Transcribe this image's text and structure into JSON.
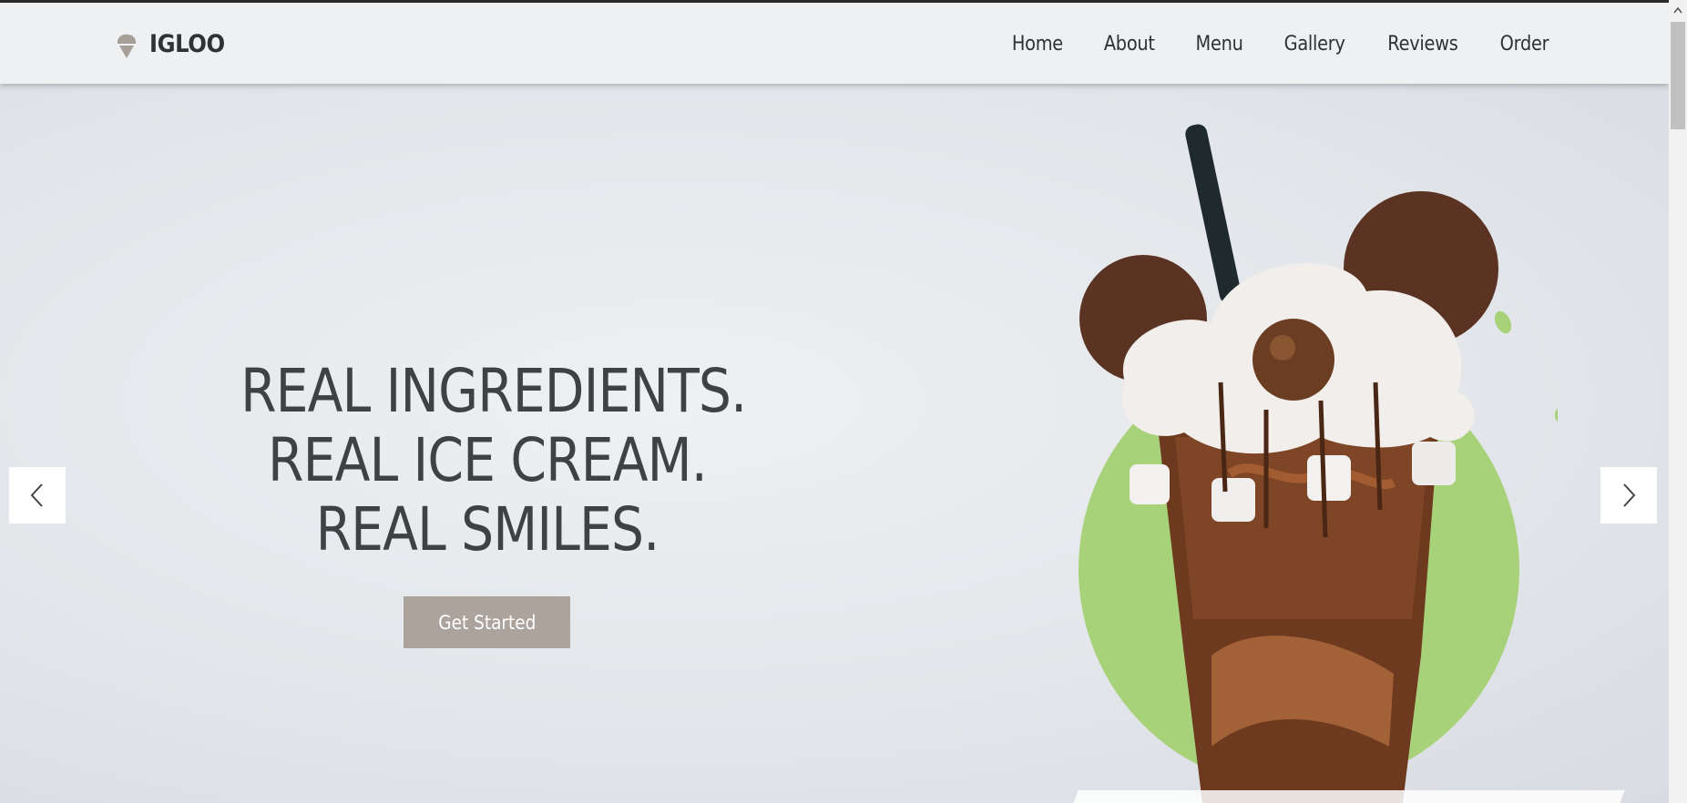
{
  "brand": {
    "name": "IGLOO",
    "icon": "ice-cream-cone-icon"
  },
  "nav": {
    "items": [
      {
        "label": "Home"
      },
      {
        "label": "About"
      },
      {
        "label": "Menu"
      },
      {
        "label": "Gallery"
      },
      {
        "label": "Reviews"
      },
      {
        "label": "Order"
      }
    ]
  },
  "hero": {
    "headline": [
      "REAL INGREDIENTS.",
      "REAL ICE CREAM.",
      "REAL SMILES."
    ],
    "cta_label": "Get Started",
    "image": "chocolate-milkshake-image"
  },
  "carousel": {
    "prev_icon": "chevron-left-icon",
    "next_icon": "chevron-right-icon"
  },
  "colors": {
    "text_dark": "#404144",
    "button_bg": "#aba39c",
    "accent_green": "#a8d27a",
    "navbar_bg": "#eff0f2"
  }
}
